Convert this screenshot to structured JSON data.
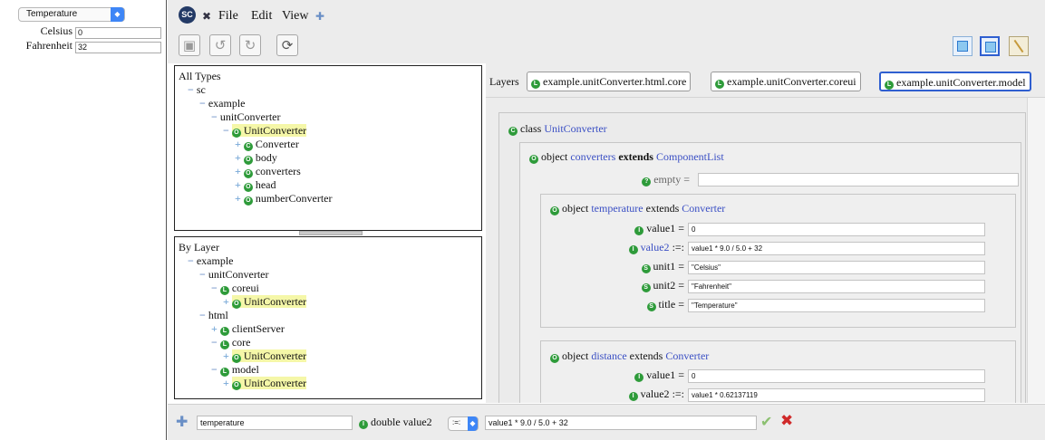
{
  "left_panel": {
    "converter_select": "Temperature",
    "fields": [
      {
        "label": "Celsius",
        "value": "0"
      },
      {
        "label": "Fahrenheit",
        "value": "32"
      }
    ]
  },
  "menubar": {
    "logo": "SC",
    "close_glyph": "✖",
    "items": [
      "File",
      "Edit",
      "View"
    ],
    "add_glyph": "✚"
  },
  "toolbar": {
    "buttons": [
      "save-icon",
      "undo-icon",
      "redo-icon",
      "refresh-icon"
    ],
    "view_buttons": [
      "type-tree-view-icon",
      "layer-tree-view-icon",
      "edit-icon"
    ]
  },
  "types_tree": {
    "header": "All Types",
    "rows": [
      {
        "expander": "−",
        "icon": "",
        "label": "sc",
        "highlight": false
      },
      {
        "expander": "−",
        "icon": "",
        "label": "example",
        "highlight": false
      },
      {
        "expander": "−",
        "icon": "",
        "label": "unitConverter",
        "highlight": false
      },
      {
        "expander": "−",
        "icon": "O",
        "label": "UnitConverter",
        "highlight": true
      },
      {
        "expander": "+",
        "icon": "C",
        "label": "Converter",
        "highlight": false
      },
      {
        "expander": "+",
        "icon": "O",
        "label": "body",
        "highlight": false
      },
      {
        "expander": "+",
        "icon": "O",
        "label": "converters",
        "highlight": false
      },
      {
        "expander": "+",
        "icon": "O",
        "label": "head",
        "highlight": false
      },
      {
        "expander": "+",
        "icon": "O",
        "label": "numberConverter",
        "highlight": false
      }
    ]
  },
  "layer_tree": {
    "header": "By Layer",
    "rows": [
      {
        "expander": "−",
        "icon": "",
        "label": "example",
        "highlight": false
      },
      {
        "expander": "−",
        "icon": "",
        "label": "unitConverter",
        "highlight": false
      },
      {
        "expander": "−",
        "icon": "L",
        "label": "coreui",
        "highlight": false
      },
      {
        "expander": "+",
        "icon": "O",
        "label": "UnitConverter",
        "highlight": true
      },
      {
        "expander": "−",
        "icon": "",
        "label": "html",
        "highlight": false
      },
      {
        "expander": "+",
        "icon": "L",
        "label": "clientServer",
        "highlight": false
      },
      {
        "expander": "−",
        "icon": "L",
        "label": "core",
        "highlight": false
      },
      {
        "expander": "+",
        "icon": "O",
        "label": "UnitConverter",
        "highlight": true
      },
      {
        "expander": "−",
        "icon": "L",
        "label": "model",
        "highlight": false
      },
      {
        "expander": "+",
        "icon": "O",
        "label": "UnitConverter",
        "highlight": true
      }
    ]
  },
  "layers": {
    "label": "Layers",
    "tabs": [
      {
        "label": "example.unitConverter.html.core",
        "selected": false
      },
      {
        "label": "example.unitConverter.coreui",
        "selected": false
      },
      {
        "label": "example.unitConverter.model",
        "selected": true
      }
    ]
  },
  "editor": {
    "class_decl": {
      "icon": "C",
      "keyword": "class",
      "name": "UnitConverter"
    },
    "converters": {
      "icon": "O",
      "keyword": "object",
      "name": "converters",
      "extends_kw": "extends",
      "extends": "ComponentList"
    },
    "empty": {
      "icon": "?",
      "name": "empty",
      "op": "=",
      "value": ""
    },
    "temperature": {
      "icon": "O",
      "keyword": "object",
      "name": "temperature",
      "extends_kw": "extends",
      "extends": "Converter",
      "props": [
        {
          "icon": "I",
          "name": "value1",
          "op": "=",
          "value": "0",
          "blue": false
        },
        {
          "icon": "I",
          "name": "value2",
          "op": ":=:",
          "value": "value1 * 9.0 / 5.0 + 32",
          "blue": true
        },
        {
          "icon": "S",
          "name": "unit1",
          "op": "=",
          "value": "\"Celsius\"",
          "blue": false
        },
        {
          "icon": "S",
          "name": "unit2",
          "op": "=",
          "value": "\"Fahrenheit\"",
          "blue": false
        },
        {
          "icon": "S",
          "name": "title",
          "op": "=",
          "value": "\"Temperature\"",
          "blue": false
        }
      ]
    },
    "distance": {
      "icon": "O",
      "keyword": "object",
      "name": "distance",
      "extends_kw": "extends",
      "extends": "Converter",
      "props": [
        {
          "icon": "I",
          "name": "value1",
          "op": "=",
          "value": "0",
          "blue": false
        },
        {
          "icon": "I",
          "name": "value2",
          "op": ":=:",
          "value": "value1 * 0.62137119",
          "blue": false
        }
      ]
    }
  },
  "bottom": {
    "add_glyph": "✚",
    "instance": "temperature",
    "icon": "I",
    "type_text": "double value2",
    "op": ":=:",
    "expression": "value1 * 9.0 / 5.0 + 32",
    "apply_glyph": "✔",
    "cancel_glyph": "✖"
  },
  "colors": {
    "accent": "#3e86f6",
    "icon_green": "#2e9b3a",
    "highlight": "#f5f7a8",
    "link_blue": "#3a4fc4"
  }
}
